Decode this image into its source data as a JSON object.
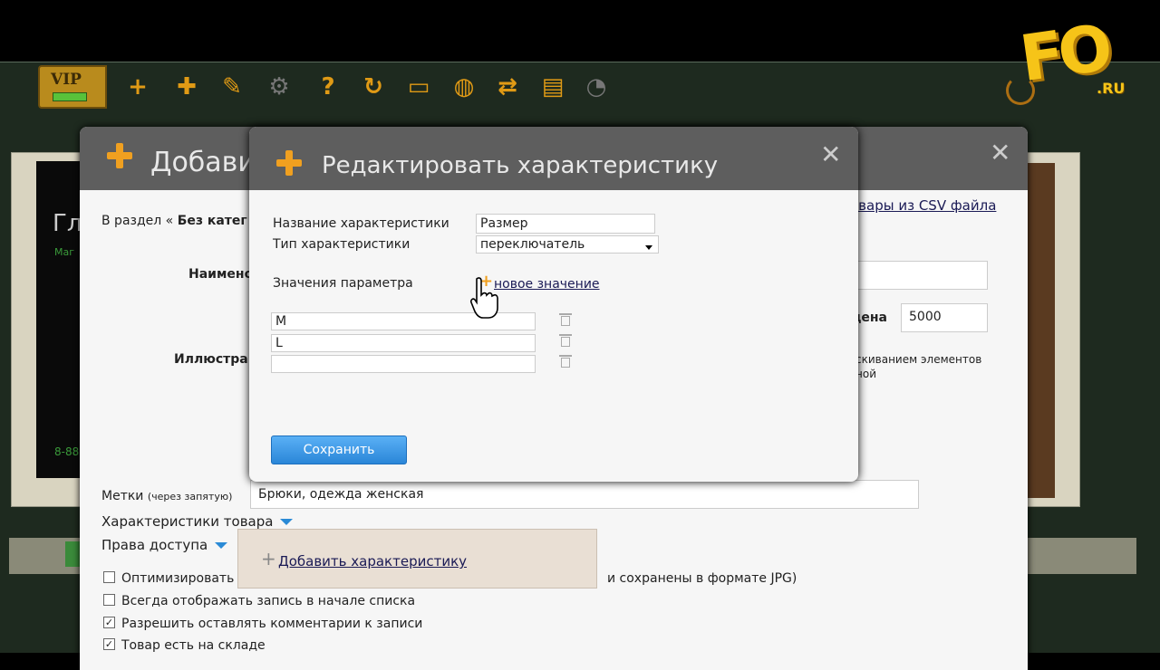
{
  "toolbar": {
    "vip_label": "VIP",
    "icons": [
      "plus-icon",
      "puzzle-icon",
      "brush-icon",
      "gear-icon",
      "help-icon",
      "refresh-icon",
      "wallet-icon",
      "globe-icon",
      "transfer-icon",
      "clipboard-icon",
      "timer-icon"
    ]
  },
  "logo": {
    "main": "FO",
    "sub": ".RU"
  },
  "background": {
    "heading": "Гл",
    "sub": "Маг",
    "phone": "8-88"
  },
  "main_modal": {
    "title": "Добави",
    "section_prefix": "В раздел «",
    "section_name": "Без катег",
    "csv_link": "овары из CSV файла",
    "name_label": "Наимено",
    "illustration_label": "Иллюстра",
    "price_label": "цена",
    "price_value": "5000",
    "drag_hint_line1": "скиванием элементов",
    "drag_hint_line2": "ной",
    "tags_label": "Метки",
    "tags_hint": "(через запятую)",
    "tags_value": "Брюки, одежда женская",
    "characteristics_toggle": "Характеристики товара",
    "access_toggle": "Права доступа",
    "add_characteristic": "Добавить характеристику",
    "checkboxes": [
      {
        "label": "Оптимизировать",
        "checked": false
      },
      {
        "label": "Всегда отображать запись в начале списка",
        "checked": false
      },
      {
        "label": "Разрешить оставлять комментарии к записи",
        "checked": true
      },
      {
        "label": "Товар есть на складе",
        "checked": true
      }
    ],
    "jpg_note": "и сохранены в формате JPG)"
  },
  "edit_modal": {
    "title": "Редактировать характеристику",
    "name_label": "Название характеристики",
    "name_value": "Размер",
    "type_label": "Тип характеристики",
    "type_value": "переключатель",
    "values_label": "Значения параметра",
    "new_value_link": "новое значение",
    "values": [
      "M",
      "L",
      ""
    ],
    "save_button": "Сохранить"
  }
}
